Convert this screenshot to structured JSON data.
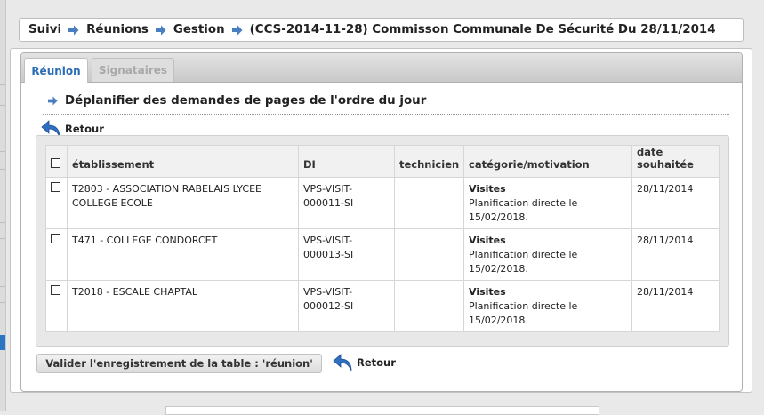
{
  "breadcrumb": {
    "items": [
      "Suivi",
      "Réunions",
      "Gestion",
      "(CCS-2014-11-28) Commisson Communale De Sécurité Du 28/11/2014"
    ]
  },
  "tabs": [
    {
      "label": "Réunion",
      "active": true
    },
    {
      "label": "Signataires",
      "active": false
    }
  ],
  "section": {
    "title": "Déplanifier des demandes de pages de l'ordre du jour"
  },
  "retour_label": "Retour",
  "table": {
    "headers": {
      "etablissement": "établissement",
      "di": "DI",
      "technicien": "technicien",
      "categorie": "catégorie/motivation",
      "date_line1": "date",
      "date_line2": "souhaitée"
    },
    "rows": [
      {
        "etab_line1": "T2803 - ASSOCIATION RABELAIS LYCEE",
        "etab_line2": "COLLEGE ECOLE",
        "di_line1": "VPS-VISIT-",
        "di_line2": "000011-SI",
        "technicien": "",
        "cat_title": "Visites",
        "cat_line1": "Planification directe le",
        "cat_line2": "15/02/2018.",
        "date": "28/11/2014"
      },
      {
        "etab_line1": "T471 - COLLEGE CONDORCET",
        "etab_line2": "",
        "di_line1": "VPS-VISIT-",
        "di_line2": "000013-SI",
        "technicien": "",
        "cat_title": "Visites",
        "cat_line1": "Planification directe le",
        "cat_line2": "15/02/2018.",
        "date": "28/11/2014"
      },
      {
        "etab_line1": "T2018 - ESCALE CHAPTAL",
        "etab_line2": "",
        "di_line1": "VPS-VISIT-",
        "di_line2": "000012-SI",
        "technicien": "",
        "cat_title": "Visites",
        "cat_line1": "Planification directe le",
        "cat_line2": "15/02/2018.",
        "date": "28/11/2014"
      }
    ]
  },
  "actions": {
    "valider_label": "Valider l'enregistrement de la table : 'réunion'",
    "retour_label": "Retour"
  },
  "icons": {
    "crumb_separator": "arrow-right-icon",
    "retour": "undo-arrow-icon"
  },
  "colors": {
    "accent": "#2a6db5",
    "arrow": "#4a7ec0"
  }
}
